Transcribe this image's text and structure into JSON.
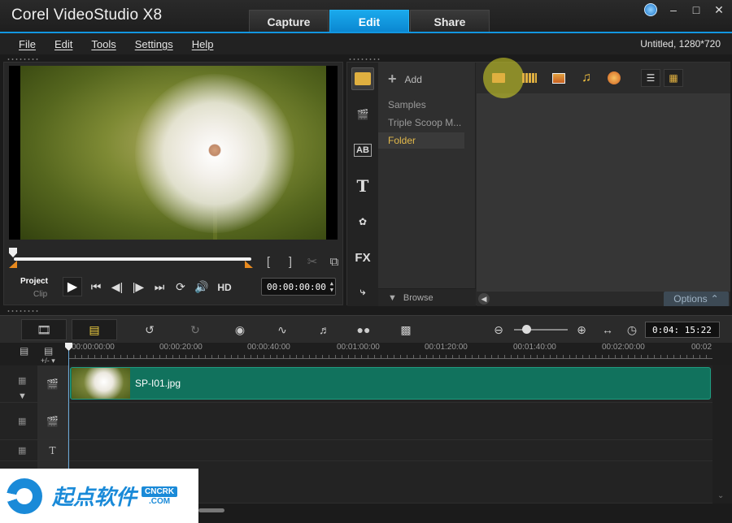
{
  "app": {
    "title": "Corel VideoStudio X8",
    "tabs": [
      {
        "label": "Capture",
        "active": false
      },
      {
        "label": "Edit",
        "active": true
      },
      {
        "label": "Share",
        "active": false
      }
    ],
    "accent_color": "#1296e0"
  },
  "menu": {
    "items": [
      "File",
      "Edit",
      "Tools",
      "Settings",
      "Help"
    ],
    "project_info": "Untitled, 1280*720"
  },
  "player": {
    "mode_project": "Project",
    "mode_clip": "Clip",
    "hd_label": "HD",
    "timecode": "00:00:00:00",
    "trim_in": "[",
    "trim_out": "]"
  },
  "library": {
    "add_label": "Add",
    "folders": [
      {
        "label": "Samples",
        "selected": false
      },
      {
        "label": "Triple Scoop M...",
        "selected": false
      },
      {
        "label": "Folder",
        "selected": true
      }
    ],
    "browse_label": "Browse",
    "options_label": "Options",
    "side_icons": [
      "media-icon",
      "instant-project-icon",
      "transition-icon",
      "title-icon",
      "graphic-icon",
      "filter-icon",
      "path-icon"
    ],
    "filter_icons": [
      "folder-icon",
      "video-filter-icon",
      "photo-filter-icon",
      "audio-filter-icon",
      "effects-filter-icon"
    ],
    "view_icons": [
      "list-view-icon",
      "thumbnail-view-icon"
    ]
  },
  "timeline": {
    "ruler_labels": [
      "00:00:00:00",
      "00:00:20:00",
      "00:00:40:00",
      "00:01:00:00",
      "00:01:20:00",
      "00:01:40:00",
      "00:02:00:00",
      "00:02"
    ],
    "duration": "0:04: 15:22",
    "clip_name": "SP-I01.jpg",
    "add_remove_label": "+/- ▾"
  },
  "watermark": {
    "text": "起点软件",
    "badge_top": "CNCRK",
    "badge_bottom": ".COM"
  }
}
